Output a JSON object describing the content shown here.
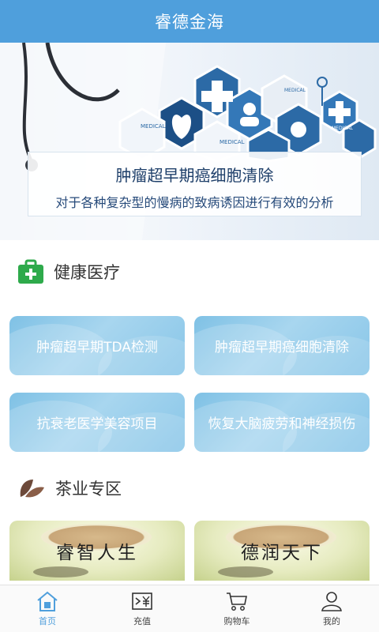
{
  "header": {
    "title": "睿德金海"
  },
  "banner": {
    "title": "肿瘤超早期癌细胞清除",
    "subtitle": "对于各种复杂型的慢病的致病诱因进行有效的分析"
  },
  "health_section": {
    "title": "健康医疗",
    "items": [
      {
        "label": "肿瘤超早期TDA检测"
      },
      {
        "label": "肿瘤超早期癌细胞清除"
      },
      {
        "label": "抗衰老医学美容项目"
      },
      {
        "label": "恢复大脑疲劳和神经损伤"
      }
    ]
  },
  "tea_section": {
    "title": "茶业专区",
    "items": [
      {
        "label": "睿智人生"
      },
      {
        "label": "德润天下"
      }
    ]
  },
  "tabbar": {
    "items": [
      {
        "label": "首页",
        "icon": "home-icon",
        "active": true
      },
      {
        "label": "充值",
        "icon": "recharge-icon",
        "active": false
      },
      {
        "label": "购物车",
        "icon": "cart-icon",
        "active": false
      },
      {
        "label": "我的",
        "icon": "user-icon",
        "active": false
      }
    ]
  },
  "colors": {
    "brand": "#4f9fdc",
    "section_icon_green": "#2eaa4b",
    "tile_blue": "#8ccbea"
  }
}
